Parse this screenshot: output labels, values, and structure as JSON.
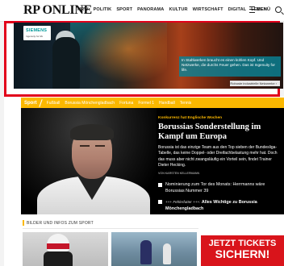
{
  "header": {
    "logo": "RP ONLINE",
    "nav": [
      "NRW",
      "POLITIK",
      "SPORT",
      "PANORAMA",
      "KULTUR",
      "WIRTSCHAFT",
      "DIGITAL",
      "LEBEN"
    ],
    "menu_label": "MENÜ"
  },
  "ad": {
    "brand": "SIEMENS",
    "claim": "Ingenuity for life",
    "copy": "In Stahlwerken braucht es einen kühlen Kopf. Und Netzwerke, die durchs Feuer gehen. Das ist Ingenuity for life.",
    "cta": "Robuste industrielle Netzwerke ›",
    "outline_color": "#e2001a"
  },
  "sportbar": {
    "label": "Sport",
    "items": [
      "Fußball",
      "Borussia Mönchengladbach",
      "Fortuna",
      "Formel 1",
      "Handball",
      "Tennis"
    ],
    "color": "#fbb800"
  },
  "hero": {
    "kicker": "Konkurrenz hat Englische Wochen",
    "title": "Borussias Sonderstellung im Kampf um Europa",
    "teaser": "Borussia ist das einzige Team aus den Top sieben der Bundesliga-Tabelle, das keine Doppel- oder Dreifachbelastung mehr hat. Doch das muss aber nicht zwangsläufig ein Vorteil sein, findet Trainer Dieter Hecking.",
    "author": "VON KARSTEN KELLERMANN",
    "related": [
      {
        "prefix": "",
        "text": "Nominierung zum Tor des Monats: Herrmanns wäre Borussias Nummer 39"
      },
      {
        "prefix": "+++ Fehlerfutter +++:",
        "text": "Alles Wichtige zu Borussia Mönchengladbach"
      }
    ]
  },
  "section": {
    "title": "BILDER UND INFOS ZUM SPORT"
  },
  "ticket_ad": {
    "line1": "JETZT TICKETS",
    "line2": "SICHERN!"
  }
}
